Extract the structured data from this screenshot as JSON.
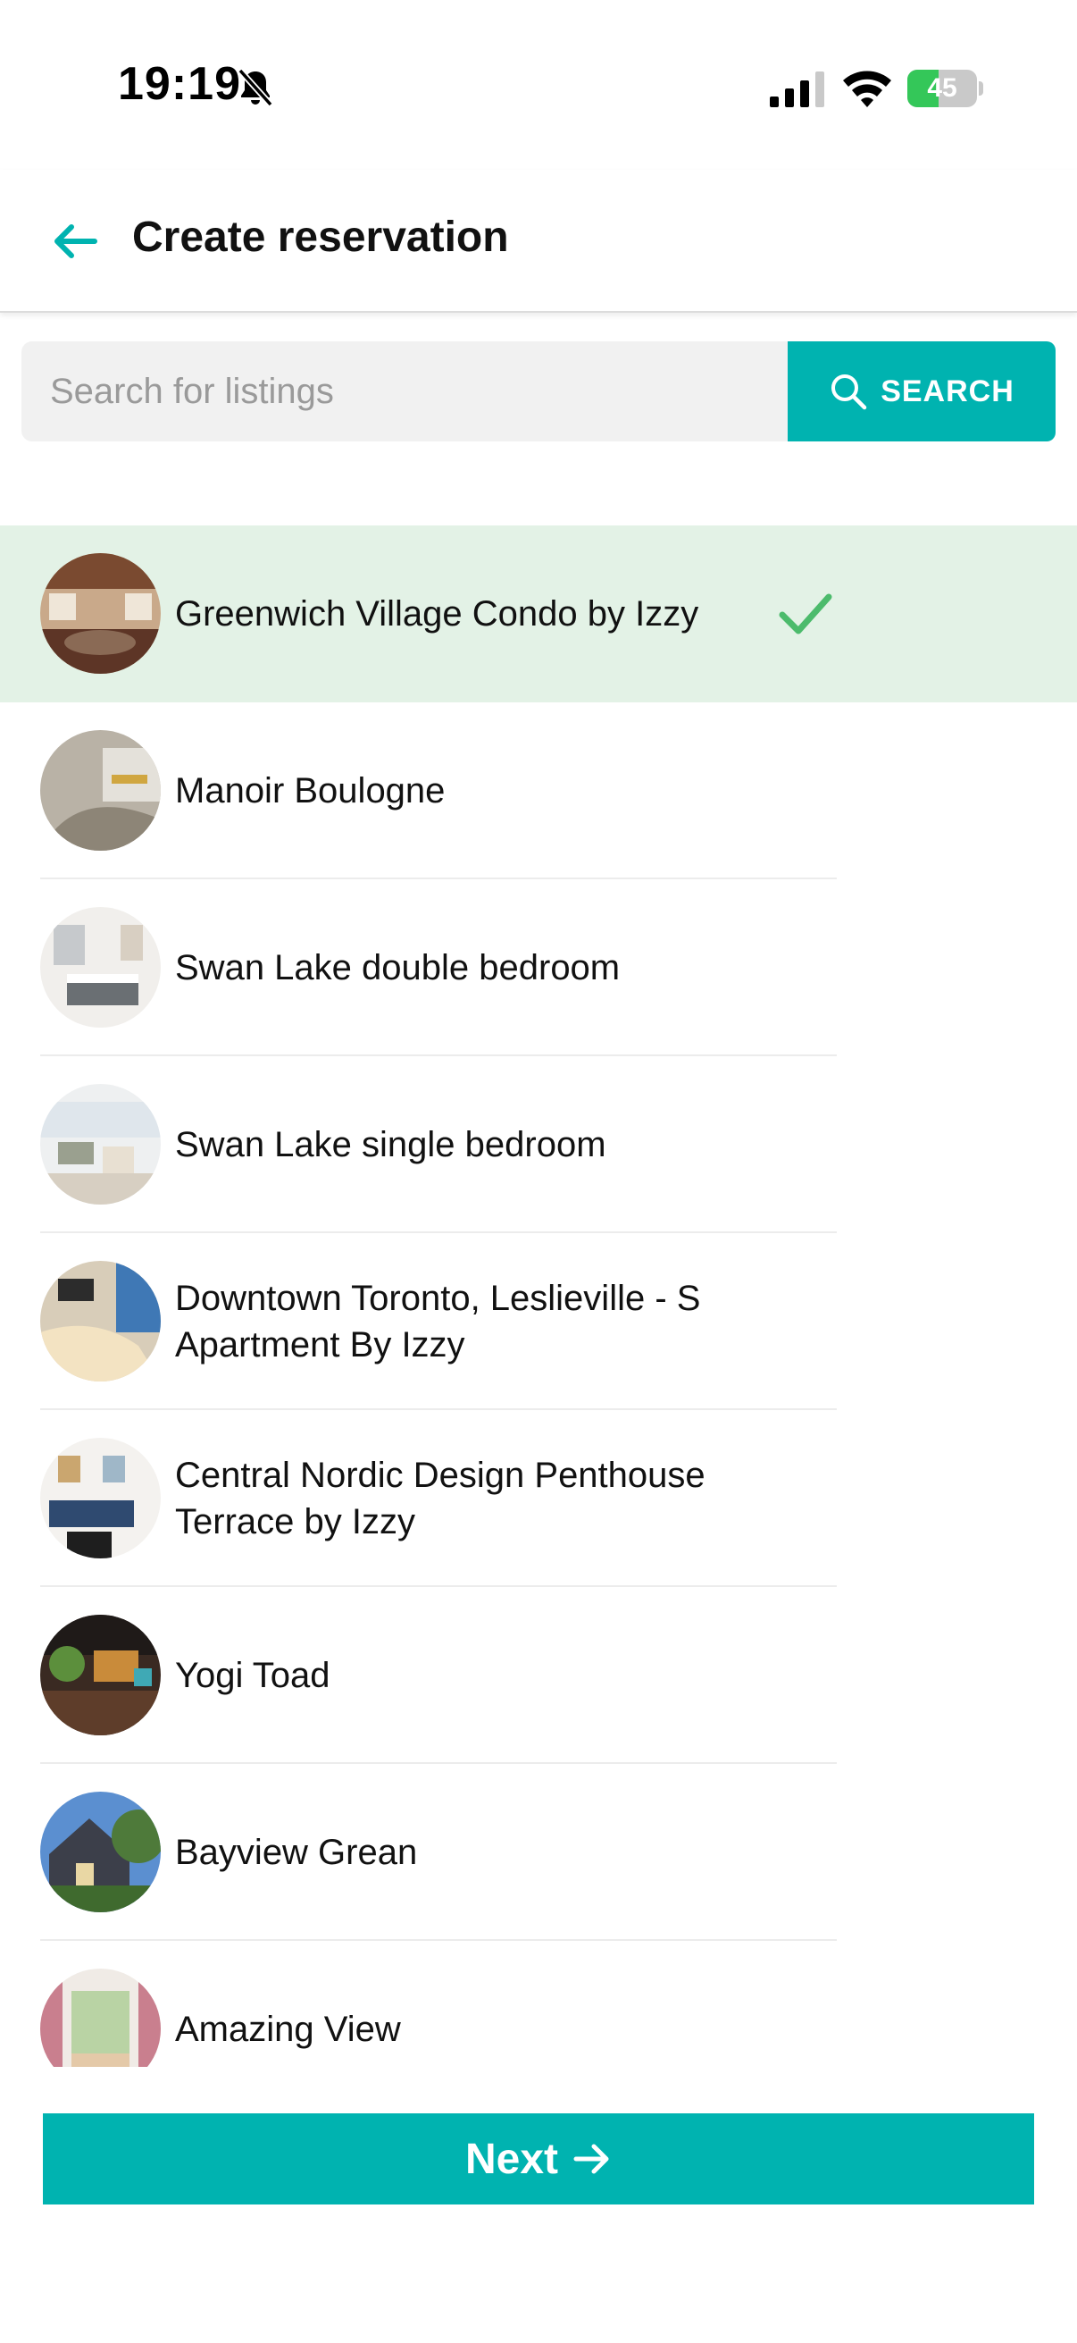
{
  "status_bar": {
    "time": "19:19",
    "battery_percent": "45",
    "battery_level": 0.45
  },
  "header": {
    "title": "Create reservation",
    "back_icon": "arrow-left-icon"
  },
  "search": {
    "placeholder": "Search for listings",
    "value": "",
    "button_label": "SEARCH",
    "button_icon": "search-icon"
  },
  "listings": [
    {
      "name": "Greenwich Village Condo by Izzy",
      "selected": true
    },
    {
      "name": "Manoir Boulogne",
      "selected": false
    },
    {
      "name": "Swan Lake double bedroom",
      "selected": false
    },
    {
      "name": "Swan Lake single bedroom",
      "selected": false
    },
    {
      "name": "Downtown Toronto, Leslieville - S Apartment By Izzy",
      "selected": false
    },
    {
      "name": "Central Nordic Design Penthouse Terrace by Izzy",
      "selected": false
    },
    {
      "name": "Yogi Toad",
      "selected": false
    },
    {
      "name": "Bayview Grean",
      "selected": false
    },
    {
      "name": "Amazing View",
      "selected": false
    }
  ],
  "footer": {
    "next_label": "Next",
    "next_icon": "arrow-right-icon"
  },
  "colors": {
    "accent": "#00b3b0",
    "selected_row": "#e3f2e6",
    "check": "#4cbb6c"
  }
}
